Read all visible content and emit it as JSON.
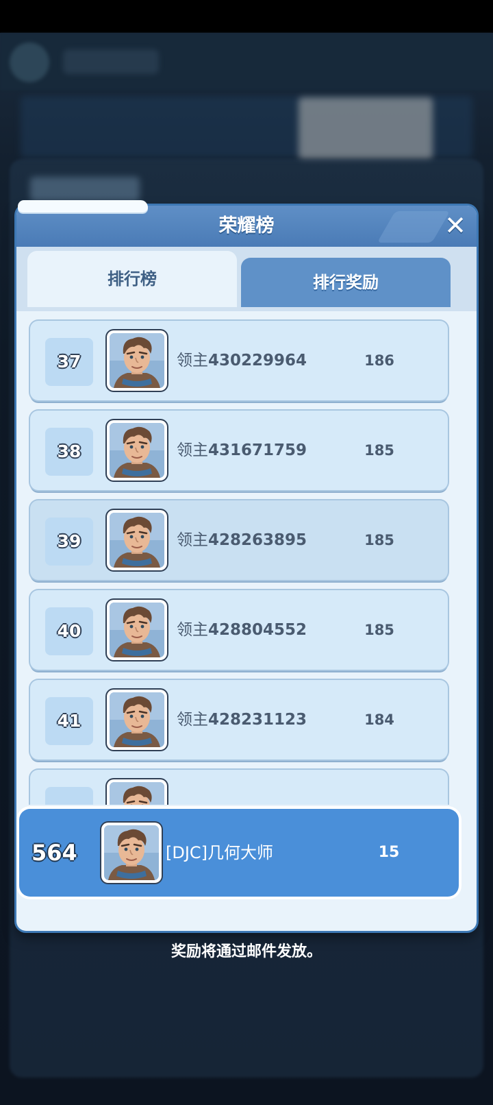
{
  "dialog": {
    "title": "荣耀榜",
    "close_icon": "close-icon"
  },
  "tabs": [
    {
      "label": "排行榜",
      "active": true
    },
    {
      "label": "排行奖励",
      "active": false
    }
  ],
  "rows": [
    {
      "rank": "37",
      "prefix": "领主",
      "id": "430229964",
      "score": "186"
    },
    {
      "rank": "38",
      "prefix": "领主",
      "id": "431671759",
      "score": "185"
    },
    {
      "rank": "39",
      "prefix": "领主",
      "id": "428263895",
      "score": "185"
    },
    {
      "rank": "40",
      "prefix": "领主",
      "id": "428804552",
      "score": "185"
    },
    {
      "rank": "41",
      "prefix": "领主",
      "id": "428231123",
      "score": "184"
    }
  ],
  "my_entry": {
    "rank": "564",
    "name": "[DJC]几何大师",
    "score": "15"
  },
  "footer_note": "奖励将通过邮件发放。",
  "colors": {
    "accent": "#4a8fd9",
    "header": "#4a7bb6",
    "row_bg": "#d6eaf9"
  }
}
